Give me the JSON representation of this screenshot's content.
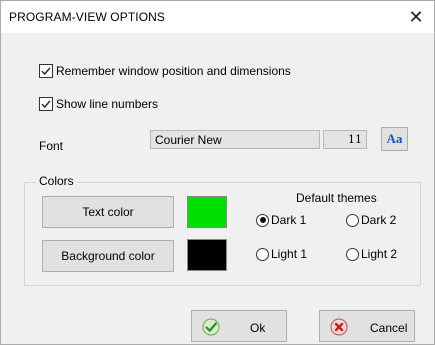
{
  "window": {
    "title": "PROGRAM-VIEW OPTIONS",
    "close_glyph": "✕"
  },
  "options": {
    "remember_position": {
      "label": "Remember window position and dimensions",
      "checked": true
    },
    "show_line_numbers": {
      "label": "Show line numbers",
      "checked": true
    }
  },
  "font": {
    "label": "Font",
    "name": "Courier New",
    "size": "11",
    "button_glyph": "Aa"
  },
  "colors": {
    "group_label": "Colors",
    "text_color_button": "Text color",
    "text_color_value": "#00e000",
    "background_color_button": "Background color",
    "background_color_value": "#000000",
    "themes_label": "Default themes",
    "themes": [
      {
        "label": "Dark 1",
        "selected": true
      },
      {
        "label": "Dark 2",
        "selected": false
      },
      {
        "label": "Light 1",
        "selected": false
      },
      {
        "label": "Light 2",
        "selected": false
      }
    ]
  },
  "buttons": {
    "ok": {
      "label": "Ok",
      "icon": "check-icon"
    },
    "cancel": {
      "label": "Cancel",
      "icon": "cancel-icon"
    }
  }
}
